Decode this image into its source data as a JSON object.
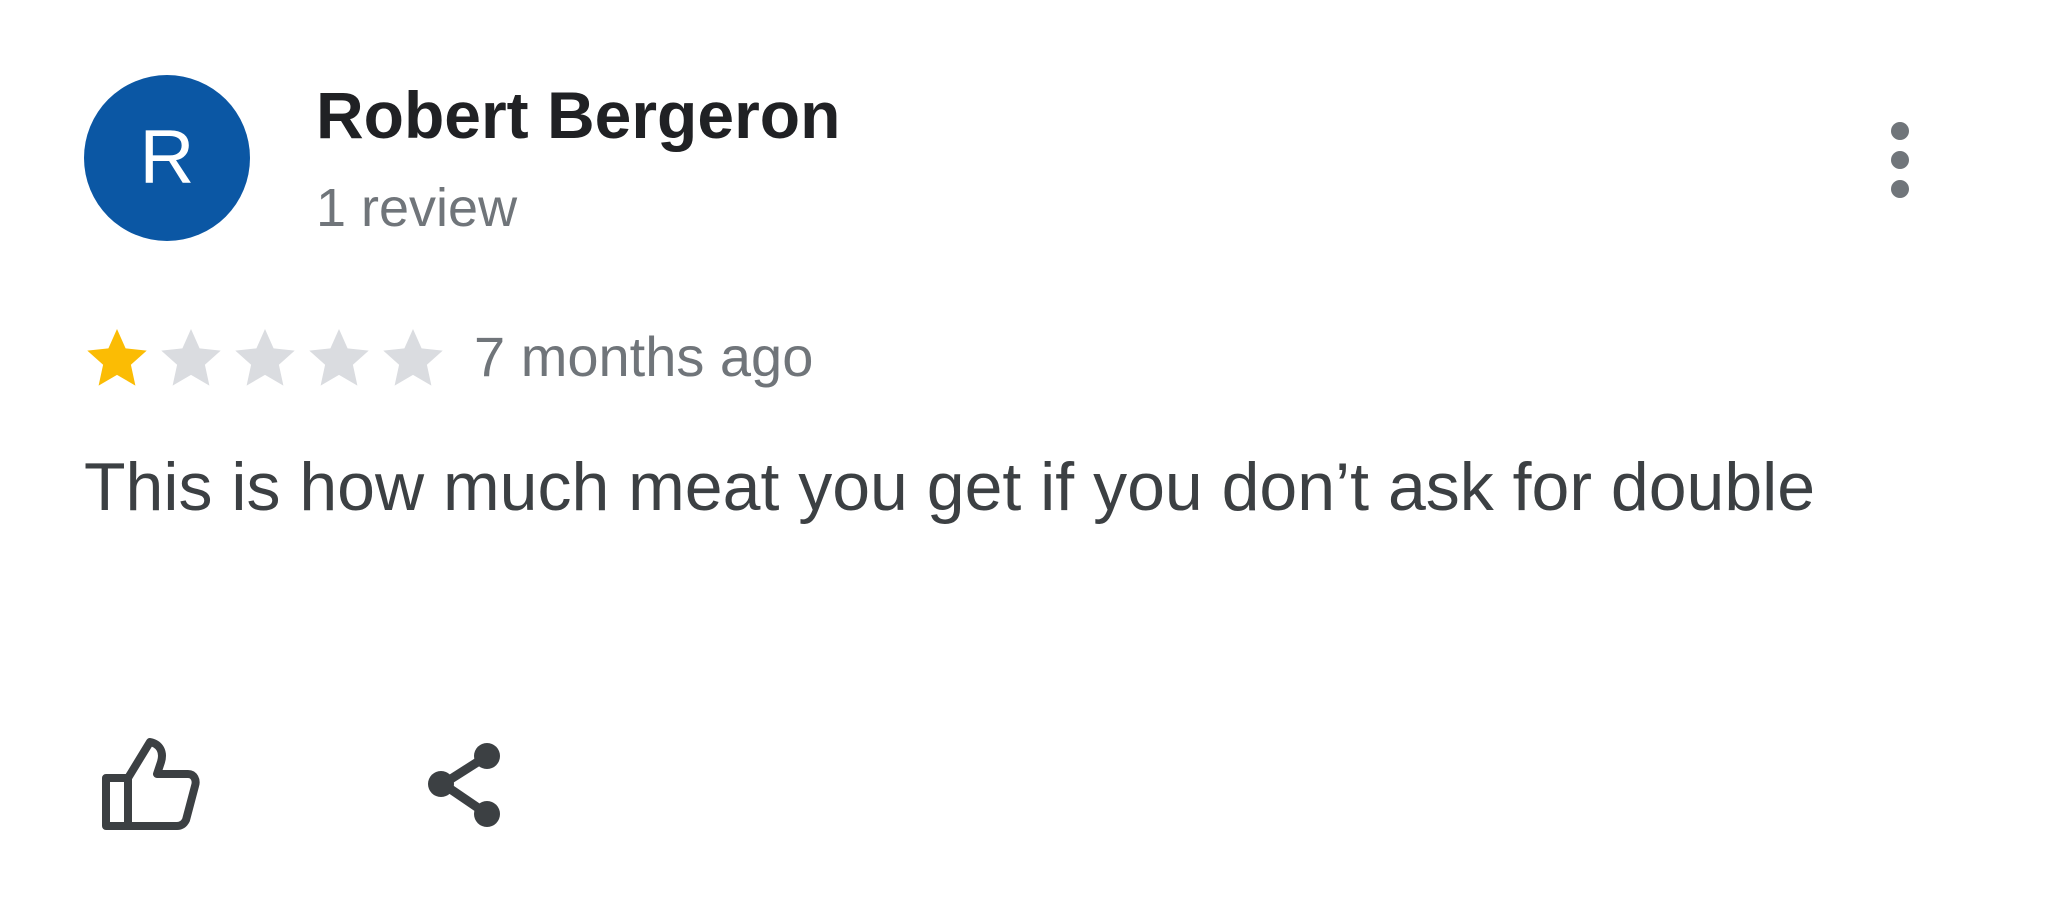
{
  "review": {
    "author": {
      "initial": "R",
      "name": "Robert Bergeron",
      "review_count": "1 review",
      "avatar_color": "#0b57a4"
    },
    "rating": {
      "value": 1,
      "max": 5,
      "filled_color": "#fbbc04",
      "empty_color": "#dadce0"
    },
    "date": "7 months ago",
    "text": "This is how much meat you get if you don’t ask for double",
    "icons": {
      "more": "more-vert-icon",
      "like": "thumb-up-icon",
      "share": "share-icon"
    }
  }
}
